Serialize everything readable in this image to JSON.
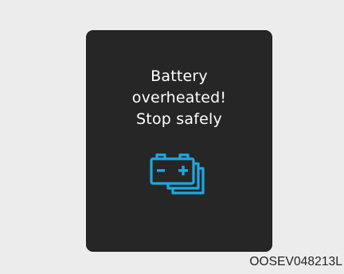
{
  "warning": {
    "lines": [
      "Battery",
      "overheated!",
      "Stop safely"
    ],
    "icon": "battery-stack-icon",
    "icon_color": "#1ea7e1",
    "panel_color": "#262626",
    "text_color": "#ffffff"
  },
  "footer": {
    "code": "OOSEV048213L"
  }
}
